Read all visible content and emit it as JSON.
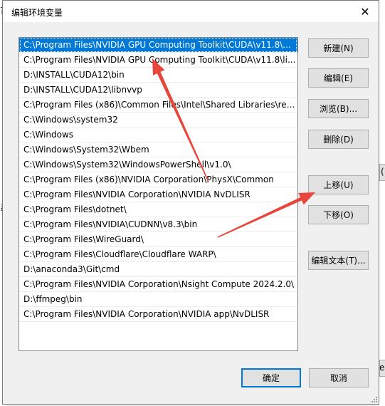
{
  "dialog": {
    "title": "编辑环境变量",
    "close_glyph": "✕"
  },
  "paths": [
    "C:\\Program Files\\NVIDIA GPU Computing Toolkit\\CUDA\\v11.8\\...",
    "C:\\Program Files\\NVIDIA GPU Computing Toolkit\\CUDA\\v11.8\\li...",
    "D:\\INSTALL\\CUDA12\\bin",
    "D:\\INSTALL\\CUDA12\\libnvvp",
    "C:\\Program Files (x86)\\Common Files\\Intel\\Shared Libraries\\red...",
    "C:\\Windows\\system32",
    "C:\\Windows",
    "C:\\Windows\\System32\\Wbem",
    "C:\\Windows\\System32\\WindowsPowerShell\\v1.0\\",
    "C:\\Program Files (x86)\\NVIDIA Corporation\\PhysX\\Common",
    "C:\\Program Files\\NVIDIA Corporation\\NVIDIA NvDLISR",
    "C:\\Program Files\\dotnet\\",
    "C:\\Program Files\\NVIDIA\\CUDNN\\v8.3\\bin",
    "C:\\Program Files\\WireGuard\\",
    "C:\\Program Files\\Cloudflare\\Cloudflare WARP\\",
    "D:\\anaconda3\\Git\\cmd",
    "C:\\Program Files\\NVIDIA Corporation\\Nsight Compute 2024.2.0\\",
    "D:\\ffmpeg\\bin",
    "C:\\Program Files\\NVIDIA Corporation\\NVIDIA app\\NvDLISR"
  ],
  "selected_index": 0,
  "buttons": {
    "new": "新建(N)",
    "edit": "编辑(E)",
    "browse": "浏览(B)...",
    "delete": "删除(D)",
    "move_up": "上移(U)",
    "move_down": "下移(O)",
    "edit_text": "编辑文本(T)...",
    "ok": "确定",
    "cancel": "取消"
  },
  "background_fragments": {
    "left_top": "?",
    "left_mid": "系",
    "right_mid": "(",
    "right_low": "e"
  },
  "colors": {
    "selection": "#0078d7",
    "annotation_arrow": "#e8463a"
  },
  "annotations": [
    "red-arrow-to-first-entry",
    "red-arrow-to-move-up-button"
  ]
}
